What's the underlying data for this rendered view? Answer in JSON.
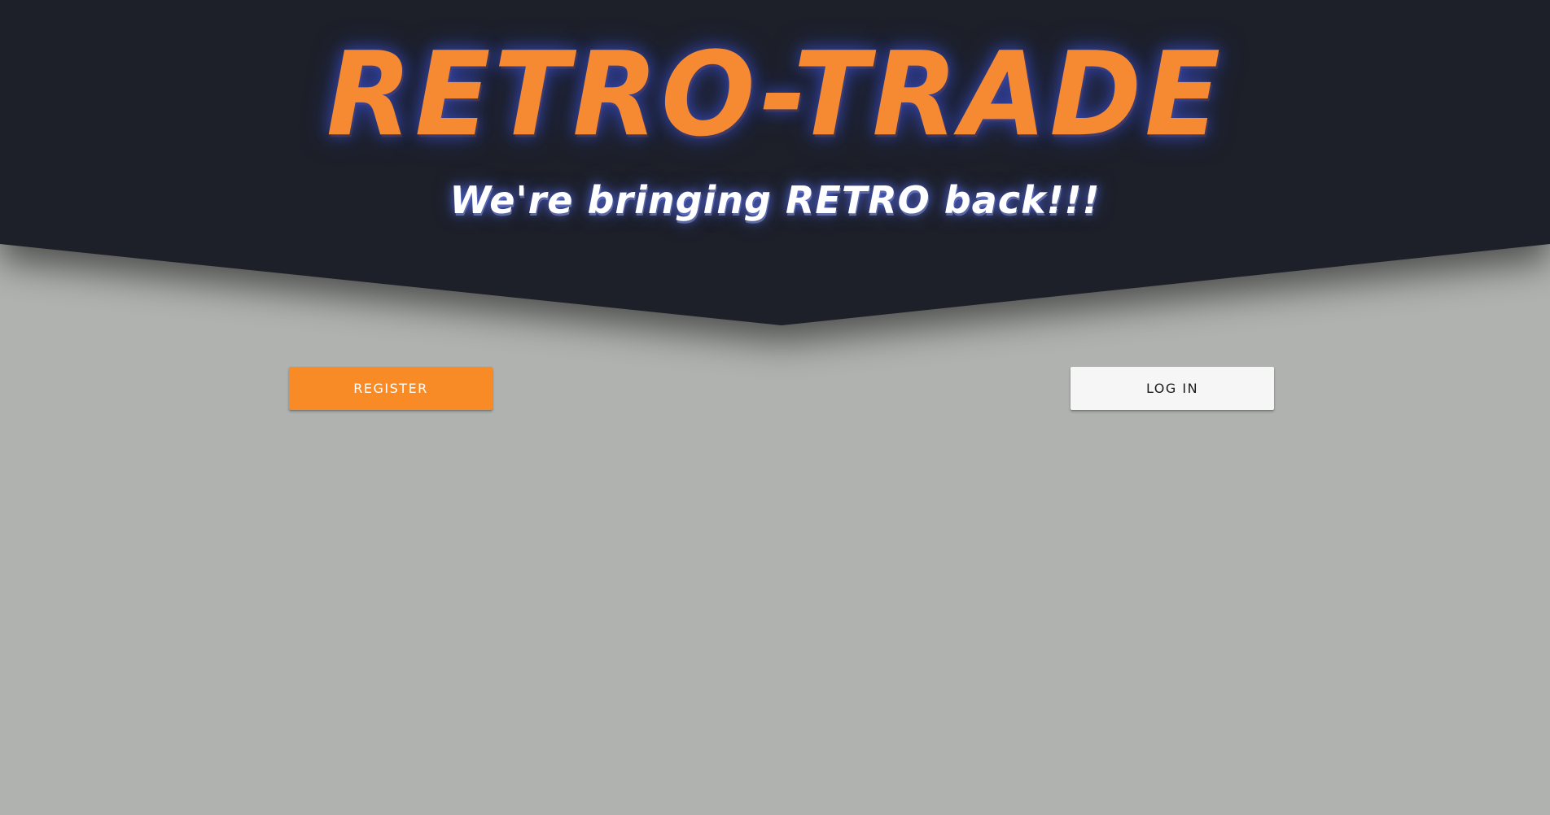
{
  "brand": {
    "title": "RETRO-TRADE",
    "tagline": "We're bringing RETRO back!!!"
  },
  "actions": {
    "register_label": "REGISTER",
    "login_label": "LOG IN"
  },
  "colors": {
    "header_background": "#1d2029",
    "page_background": "#b0b2af",
    "accent_orange": "#f88b26",
    "login_button": "#f6f6f6"
  }
}
